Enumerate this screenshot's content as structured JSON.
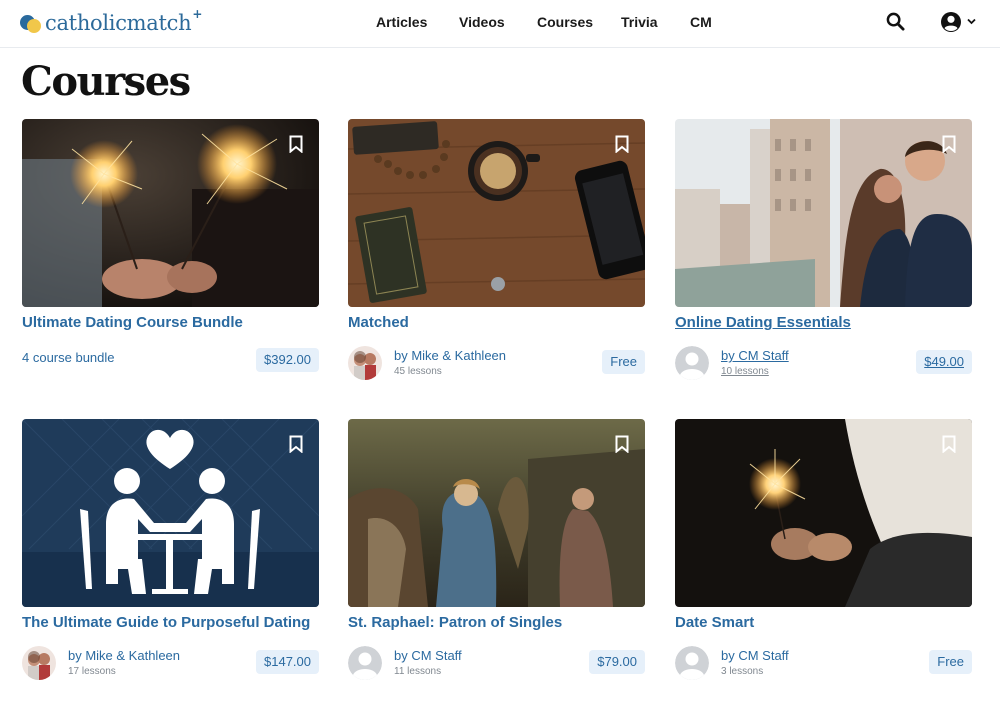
{
  "header": {
    "logo_text": "catholicmatch",
    "logo_plus": "+",
    "nav": [
      "Articles",
      "Videos",
      "Courses",
      "Trivia",
      "CM"
    ],
    "icons": [
      "search-icon",
      "account-icon",
      "chevron-down-icon"
    ]
  },
  "page": {
    "title": "Courses"
  },
  "cards": [
    {
      "title": "Ultimate Dating Course Bundle",
      "subtitle": "4 course bundle",
      "price": "$392.00"
    },
    {
      "title": "Matched",
      "author": "by Mike & Kathleen",
      "lessons": "45 lessons",
      "price": "Free"
    },
    {
      "title": "Online Dating Essentials",
      "author": "by CM Staff",
      "lessons": "10 lessons",
      "price": "$49.00"
    },
    {
      "title": "The Ultimate Guide to Purposeful Dating",
      "author": "by Mike & Kathleen",
      "lessons": "17 lessons",
      "price": "$147.00"
    },
    {
      "title": "St. Raphael: Patron of Singles",
      "author": "by CM Staff",
      "lessons": "11 lessons",
      "price": "$79.00"
    },
    {
      "title": "Date Smart",
      "author": "by CM Staff",
      "lessons": "3 lessons",
      "price": "Free"
    }
  ],
  "colors": {
    "brand": "#2b6aa0",
    "accent_yellow": "#f1c74a",
    "price_bg": "#e6f0fa"
  }
}
